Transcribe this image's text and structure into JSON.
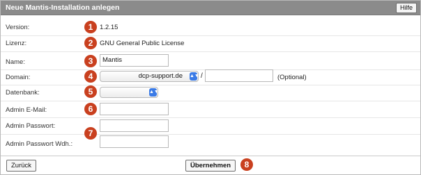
{
  "window": {
    "title": "Neue Mantis-Installation anlegen",
    "help_label": "Hilfe"
  },
  "fields": {
    "version": {
      "label": "Version:",
      "value": "1.2.15",
      "badge": "1"
    },
    "license": {
      "label": "Lizenz:",
      "value": "GNU General Public License",
      "badge": "2"
    },
    "name": {
      "label": "Name:",
      "value": "Mantis",
      "badge": "3"
    },
    "domain": {
      "label": "Domain:",
      "selected": "dcp-support.de",
      "separator": "/",
      "path_value": "",
      "optional": "(Optional)",
      "badge": "4"
    },
    "database": {
      "label": "Datenbank:",
      "selected": "",
      "badge": "5"
    },
    "admin_email": {
      "label": "Admin E-Mail:",
      "value": "",
      "badge": "6"
    },
    "admin_password": {
      "label": "Admin Passwort:",
      "value": ""
    },
    "admin_password_repeat": {
      "label": "Admin Passwort Wdh.:",
      "value": "",
      "badge": "7"
    }
  },
  "footer": {
    "back_label": "Zurück",
    "submit_label": "Übernehmen",
    "badge": "8"
  },
  "colors": {
    "titlebar": "#8b8b8b",
    "badge": "#c9401f",
    "select_arrow": "#3b7be6"
  }
}
